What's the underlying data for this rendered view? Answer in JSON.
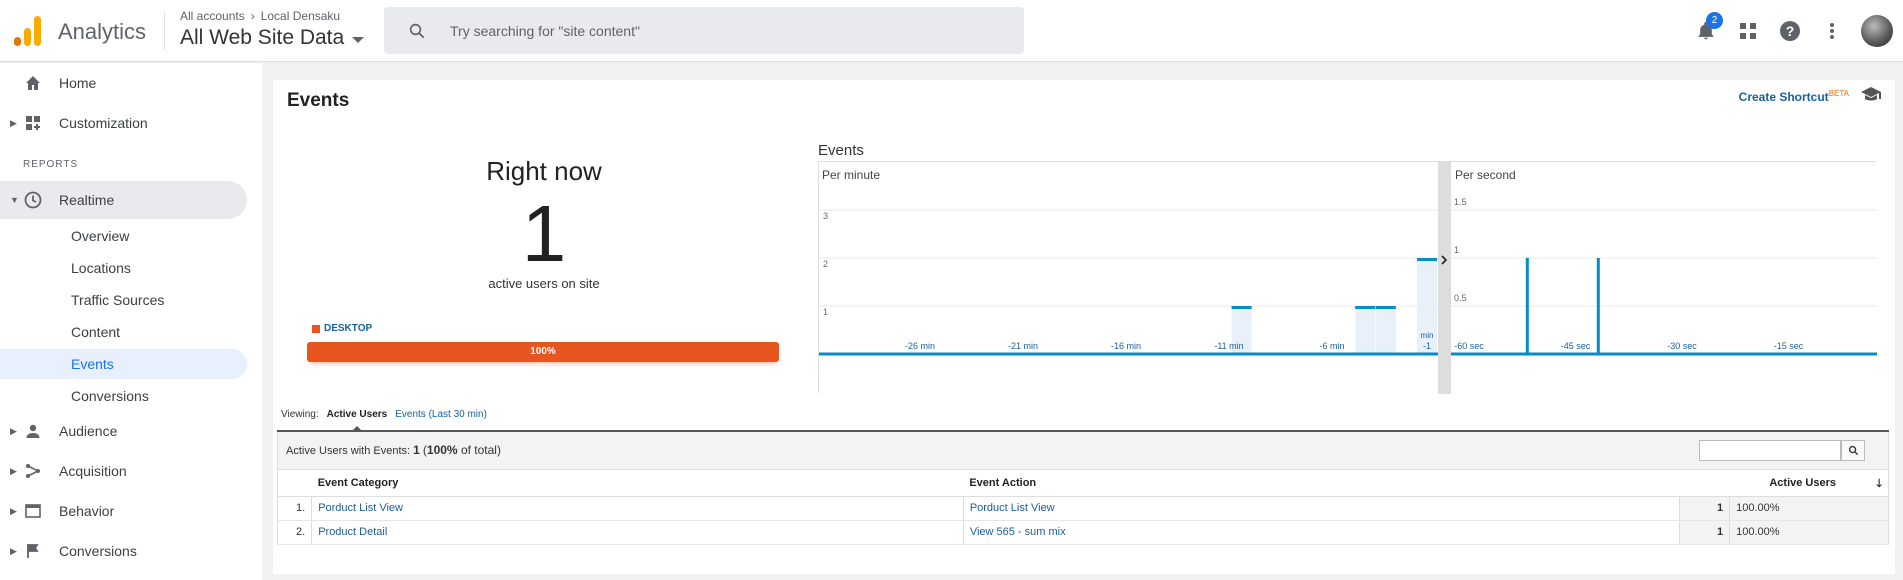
{
  "header": {
    "app_name": "Analytics",
    "breadcrumb_account": "All accounts",
    "breadcrumb_property": "Local Densaku",
    "property_name": "All Web Site Data",
    "search_placeholder": "Try searching for \"site content\"",
    "notification_count": "2"
  },
  "sidebar": {
    "home": "Home",
    "customization": "Customization",
    "reports_label": "REPORTS",
    "realtime": "Realtime",
    "realtime_items": [
      "Overview",
      "Locations",
      "Traffic Sources",
      "Content",
      "Events",
      "Conversions"
    ],
    "audience": "Audience",
    "acquisition": "Acquisition",
    "behavior": "Behavior",
    "conversions": "Conversions"
  },
  "main": {
    "title": "Events",
    "shortcut": "Create Shortcut",
    "shortcut_badge": "BETA",
    "right_now_title": "Right now",
    "active_users": "1",
    "active_users_label": "active users on site",
    "device_label": "DESKTOP",
    "device_share": "100%",
    "device_share_value": 100
  },
  "chart_data": [
    {
      "type": "bar",
      "title": "Events",
      "subtitle": "Per minute",
      "x_ticks": [
        "-26 min",
        "-21 min",
        "-16 min",
        "-11 min",
        "-6 min",
        "min -1"
      ],
      "y_ticks": [
        "1",
        "2",
        "3"
      ],
      "ylim": [
        0,
        3
      ],
      "bars": [
        {
          "minute": -10,
          "value": 1
        },
        {
          "minute": -4,
          "value": 1
        },
        {
          "minute": -3,
          "value": 1
        },
        {
          "minute": -1,
          "value": 2
        }
      ]
    },
    {
      "type": "bar",
      "subtitle": "Per second",
      "x_ticks": [
        "-60 sec",
        "-45 sec",
        "-30 sec",
        "-15 sec"
      ],
      "y_ticks": [
        "0.5",
        "1",
        "1.5"
      ],
      "ylim": [
        0,
        2
      ],
      "bars": [
        {
          "second": -52,
          "value": 1
        },
        {
          "second": -42,
          "value": 1
        }
      ]
    }
  ],
  "viewing": {
    "label": "Viewing:",
    "active_tab": "Active Users",
    "other_tab": "Events (Last 30 min)"
  },
  "table": {
    "summary_label": "Active Users with Events:",
    "summary_value": "1",
    "summary_pct": "100%",
    "summary_suffix": "of total)",
    "columns": [
      "Event Category",
      "Event Action",
      "Active Users"
    ],
    "rows": [
      {
        "index": "1.",
        "category": "Porduct List View",
        "action": "Porduct List View",
        "users": "1",
        "pct": "100.00%"
      },
      {
        "index": "2.",
        "category": "Product Detail",
        "action": "View 565 - sum mix",
        "users": "1",
        "pct": "100.00%"
      }
    ]
  }
}
